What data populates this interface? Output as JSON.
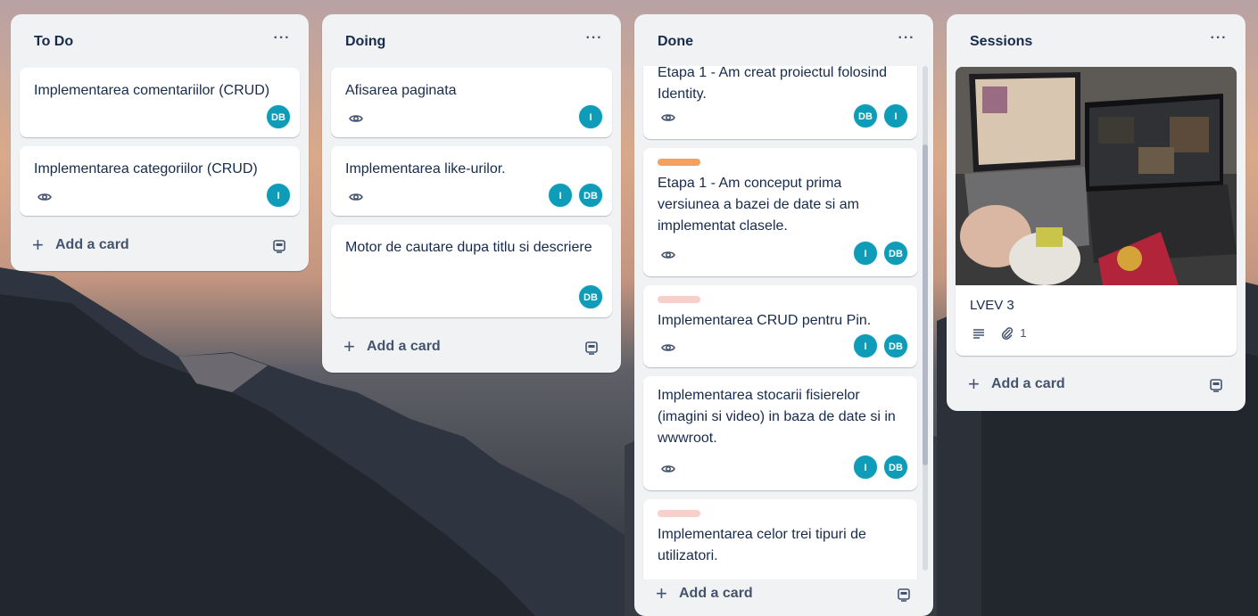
{
  "lists": [
    {
      "title": "To Do",
      "menu": "···",
      "cards": [
        {
          "title": "Implementarea comentariilor (CRUD)",
          "watched": false,
          "members": [
            "DB"
          ]
        },
        {
          "title": "Implementarea categoriilor (CRUD)",
          "watched": true,
          "members": [
            "I"
          ]
        }
      ],
      "add_label": "Add a card"
    },
    {
      "title": "Doing",
      "menu": "···",
      "cards": [
        {
          "title": "Afisarea paginata",
          "watched": true,
          "members": [
            "I"
          ]
        },
        {
          "title": "Implementarea like-urilor.",
          "watched": true,
          "members": [
            "I",
            "DB"
          ]
        },
        {
          "title": "Motor de cautare dupa titlu si descriere",
          "watched": false,
          "members": [
            "DB"
          ]
        }
      ],
      "add_label": "Add a card"
    },
    {
      "title": "Done",
      "menu": "···",
      "cards": [
        {
          "title": "Etapa 1 - Am creat proiectul folosind Identity.",
          "watched": true,
          "members": [
            "DB",
            "I"
          ]
        },
        {
          "title": "Etapa 1 - Am conceput prima versiunea a bazei de date si am implementat clasele.",
          "label_color": "#f5a05c",
          "watched": true,
          "members": [
            "I",
            "DB"
          ]
        },
        {
          "title": "Implementarea CRUD pentru Pin.",
          "label_color": "#f8cfcb",
          "watched": true,
          "members": [
            "I",
            "DB"
          ]
        },
        {
          "title": "Implementarea stocarii fisierelor (imagini si video) in baza de date si in wwwroot.",
          "watched": true,
          "members": [
            "I",
            "DB"
          ]
        },
        {
          "title": "Implementarea celor trei tipuri de utilizatori.",
          "label_color": "#f8cfcb",
          "watched": false,
          "members": []
        }
      ],
      "add_label": "Add a card"
    },
    {
      "title": "Sessions",
      "menu": "···",
      "cards": [
        {
          "title": "LVEV 3",
          "has_cover": true,
          "has_description": true,
          "attachments": "1"
        }
      ],
      "add_label": "Add a card"
    }
  ],
  "colors": {
    "avatar": "#0e9cb8",
    "list_bg": "#f1f2f4",
    "text": "#172b4d",
    "muted": "#44546f"
  },
  "icons": {
    "watch": "eye-icon",
    "add": "plus-icon",
    "template": "card-template-icon",
    "menu": "more-horizontal-icon",
    "description": "description-icon",
    "attachment": "paperclip-icon"
  }
}
